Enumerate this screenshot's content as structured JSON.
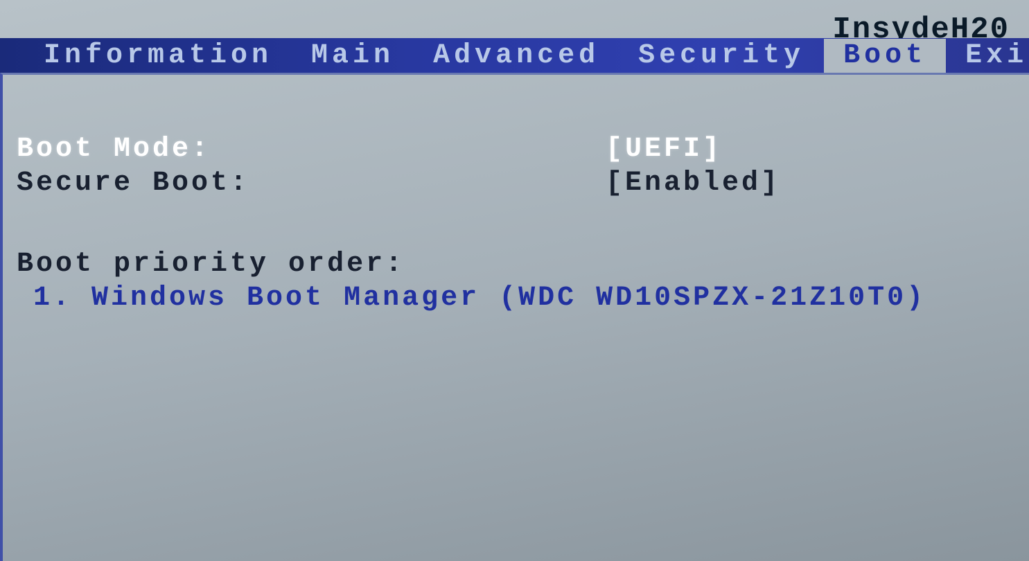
{
  "brand": "InsydeH20",
  "tabs": [
    {
      "label": "Information",
      "active": false
    },
    {
      "label": "Main",
      "active": false
    },
    {
      "label": "Advanced",
      "active": false
    },
    {
      "label": "Security",
      "active": false
    },
    {
      "label": "Boot",
      "active": true
    },
    {
      "label": "Exit",
      "active": false
    }
  ],
  "settings": {
    "boot_mode": {
      "label": "Boot Mode:",
      "value": "[UEFI]",
      "highlighted": true
    },
    "secure_boot": {
      "label": "Secure Boot:",
      "value": "[Enabled]",
      "highlighted": false
    }
  },
  "boot_priority": {
    "header": "Boot priority order:",
    "items": [
      "1. Windows Boot Manager (WDC WD10SPZX-21Z10T0)"
    ]
  }
}
